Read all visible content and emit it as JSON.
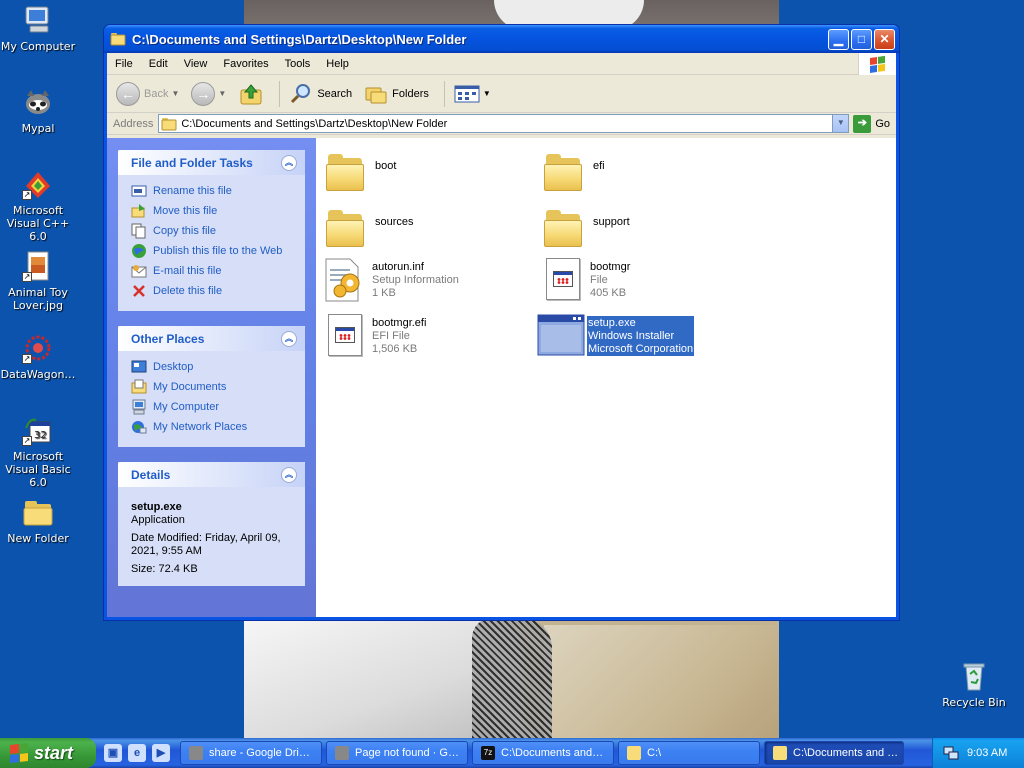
{
  "desktop": {
    "icons": [
      {
        "label": "My Computer"
      },
      {
        "label": "Mypal"
      },
      {
        "label": "Microsoft Visual C++ 6.0"
      },
      {
        "label": "Animal Toy Lover.jpg"
      },
      {
        "label": "DataWagon…"
      },
      {
        "label": "Microsoft Visual Basic 6.0"
      },
      {
        "label": "New Folder"
      },
      {
        "label": "Recycle Bin"
      }
    ]
  },
  "window": {
    "title": "C:\\Documents and Settings\\Dartz\\Desktop\\New Folder",
    "menu": [
      "File",
      "Edit",
      "View",
      "Favorites",
      "Tools",
      "Help"
    ],
    "toolbar": {
      "back": "Back",
      "search": "Search",
      "folders": "Folders"
    },
    "address": {
      "label": "Address",
      "value": "C:\\Documents and Settings\\Dartz\\Desktop\\New Folder",
      "go": "Go"
    }
  },
  "taskpane": {
    "file_tasks": {
      "title": "File and Folder Tasks",
      "items": [
        "Rename this file",
        "Move this file",
        "Copy this file",
        "Publish this file to the Web",
        "E-mail this file",
        "Delete this file"
      ]
    },
    "other_places": {
      "title": "Other Places",
      "items": [
        "Desktop",
        "My Documents",
        "My Computer",
        "My Network Places"
      ]
    },
    "details": {
      "title": "Details",
      "name": "setup.exe",
      "type": "Application",
      "modified_1": "Date Modified: Friday, April 09,",
      "modified_2": "2021, 9:55 AM",
      "size": "Size: 72.4 KB"
    }
  },
  "files": [
    {
      "name": "boot",
      "line2": "",
      "line3": ""
    },
    {
      "name": "efi",
      "line2": "",
      "line3": ""
    },
    {
      "name": "sources",
      "line2": "",
      "line3": ""
    },
    {
      "name": "support",
      "line2": "",
      "line3": ""
    },
    {
      "name": "autorun.inf",
      "line2": "Setup Information",
      "line3": "1 KB"
    },
    {
      "name": "bootmgr",
      "line2": "File",
      "line3": "405 KB"
    },
    {
      "name": "bootmgr.efi",
      "line2": "EFI File",
      "line3": "1,506 KB"
    },
    {
      "name": "setup.exe",
      "line2": "Windows Installer",
      "line3": "Microsoft Corporation"
    }
  ],
  "taskbar": {
    "start": "start",
    "buttons": [
      "share - Google Dri…",
      "Page not found · G…",
      "C:\\Documents and…",
      "C:\\",
      "C:\\Documents and …"
    ],
    "clock": "9:03 AM"
  },
  "colors": {
    "selection": "#316ac5",
    "link": "#215dc6",
    "titlebar": "#0553df"
  }
}
